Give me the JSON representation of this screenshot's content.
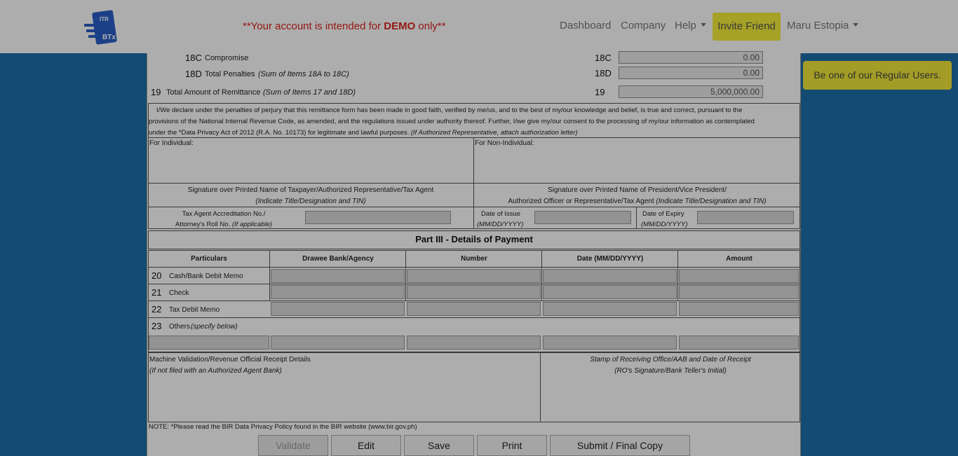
{
  "nav": {
    "logo_text": "ITR BTx",
    "demo_prefix": "**Your account is intended for ",
    "demo_word": "DEMO",
    "demo_suffix": " only**",
    "links": [
      "Dashboard",
      "Company",
      "Help"
    ],
    "invite": "Invite Friend",
    "user": "Maru Estopia"
  },
  "promo": "Be one of our Regular Users.",
  "items": {
    "i18c": {
      "no": "18C",
      "label": "Compromise",
      "code": "18C",
      "value": "0.00"
    },
    "i18d": {
      "no": "18D",
      "label": "Total Penalties",
      "hint": "(Sum of Items 18A to 18C)",
      "code": "18D",
      "value": "0.00"
    },
    "i19": {
      "no": "19",
      "label": "Total Amount of Remittance",
      "hint": "(Sum of Items 17 and 18D)",
      "code": "19",
      "value": "5,000,000.00"
    }
  },
  "declaration": {
    "line1": "I/We declare under the penalties of perjury that this remittance form has been made in good faith, verified by me/us, and to the best of my/our knowledge and belief, is true and correct, pursuant to the",
    "line2": "provisions of the National Internal Revenue Code, as amended, and the regulations issued under authority thereof. Further, I/we give my/our consent to the processing of my/our information as contemplated",
    "line3": "under the *Data Privacy Act of 2012 (R.A. No. 10173) for legitimate and lawful purposes.",
    "line3_italic": "(If Authorized Representative, attach authorization letter)"
  },
  "signatures": {
    "individual": "For Individual:",
    "non_individual": "For Non-Individual:",
    "ind_sig1": "Signature over Printed Name of Taxpayer/Authorized Representative/Tax Agent",
    "ind_sig2": "(Indicate Title/Designation and TIN)",
    "non_sig1": "Signature over Printed Name of President/Vice President/",
    "non_sig2a": "Authorized Officer or Representative/Tax Agent",
    "non_sig2b": "(Indicate Title/Designation and TIN)",
    "accr1": "Tax Agent Accreditation No./",
    "accr2a": "Attorney's Roll No.",
    "accr2b": "(If applicable)",
    "issue1": "Date of Issue",
    "issue2": "(MM/DD/YYYY)",
    "expiry1": "Date of Expiry",
    "expiry2": "(MM/DD/YYYY)"
  },
  "part3": {
    "title": "Part III - Details of Payment",
    "headers": [
      "Particulars",
      "Drawee Bank/Agency",
      "Number",
      "Date (MM/DD/YYYY)",
      "Amount"
    ],
    "rows": [
      {
        "no": "20",
        "label": "Cash/Bank Debit Memo"
      },
      {
        "no": "21",
        "label": "Check"
      },
      {
        "no": "22",
        "label": "Tax Debit Memo"
      },
      {
        "no": "23",
        "label": "Others",
        "hint": "(specify below)"
      }
    ]
  },
  "validation": {
    "line1": "Machine Validation/Revenue Official Receipt Details",
    "line2": "(If not filed with an Authorized Agent Bank)",
    "stamp1": "Stamp of Receiving Office/AAB and Date of Receipt",
    "stamp2": "(RO's Signature/Bank Teller's Initial)"
  },
  "note": "NOTE: *Please read the BIR Data Privacy Policy found in the BIR website (www.bir.gov.ph)",
  "buttons": {
    "validate": "Validate",
    "edit": "Edit",
    "save": "Save",
    "print": "Print",
    "submit": "Submit / Final Copy"
  },
  "colors": {
    "page_bg": "#1d6fa9",
    "demo_red": "#d9251d",
    "invite_yellow": "#f5ee3a",
    "overlay": "rgba(0,0,0,0.32)"
  }
}
